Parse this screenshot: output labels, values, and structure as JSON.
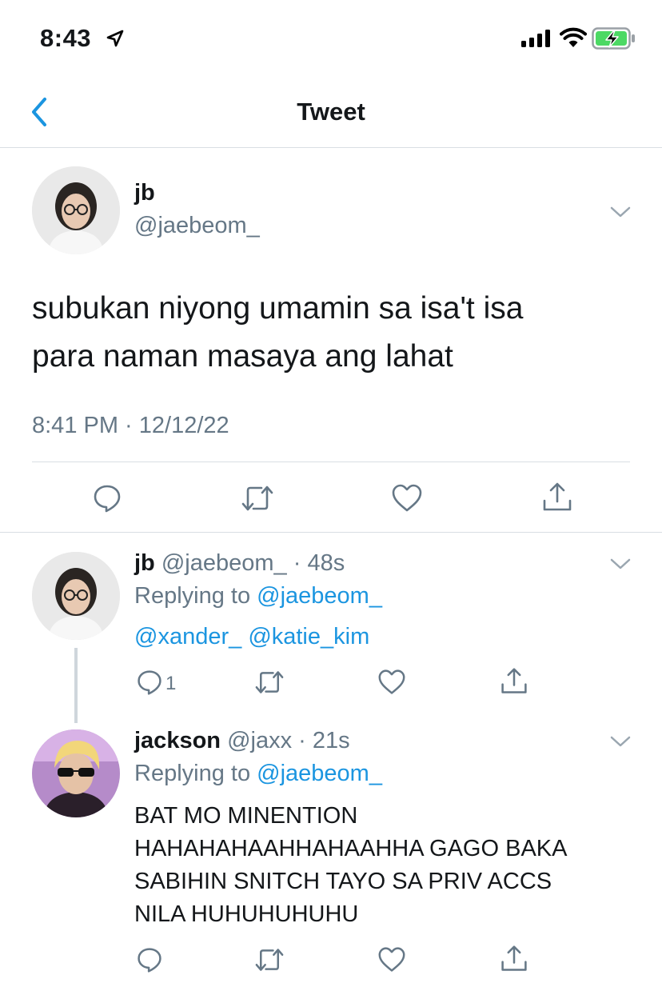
{
  "status_bar": {
    "time": "8:43"
  },
  "header": {
    "title": "Tweet"
  },
  "main_tweet": {
    "name": "jb",
    "handle": "@jaebeom_",
    "text_line1": "subukan niyong umamin sa isa't isa",
    "text_line2": "para naman masaya ang lahat",
    "timestamp": "8:41 PM · 12/12/22"
  },
  "replies": [
    {
      "name": "jb",
      "handle": "@jaebeom_",
      "separator": " · ",
      "age": "48s",
      "replying_prefix": "Replying to ",
      "replying_to": "@jaebeom_",
      "mention1": "@xander_",
      "mention2": "@katie_kim",
      "reply_count": "1"
    },
    {
      "name": "jackson",
      "handle": "@jaxx",
      "separator": " · ",
      "age": "21s",
      "replying_prefix": "Replying to ",
      "replying_to": "@jaebeom_",
      "text_line1": "BAT MO MINENTION",
      "text_line2": "HAHAHAHAAHHAHAAHHA GAGO BAKA",
      "text_line3": "SABIHIN SNITCH TAYO SA PRIV ACCS",
      "text_line4": "NILA HUHUHUHUHU"
    }
  ],
  "icons": {
    "back": "chevron-left-icon",
    "caret": "chevron-down-icon",
    "reply": "comment-icon",
    "retweet": "retweet-icon",
    "like": "heart-icon",
    "share": "share-icon"
  },
  "colors": {
    "link": "#1b95e0",
    "secondary_text": "#657786",
    "battery_green": "#4cd964"
  }
}
